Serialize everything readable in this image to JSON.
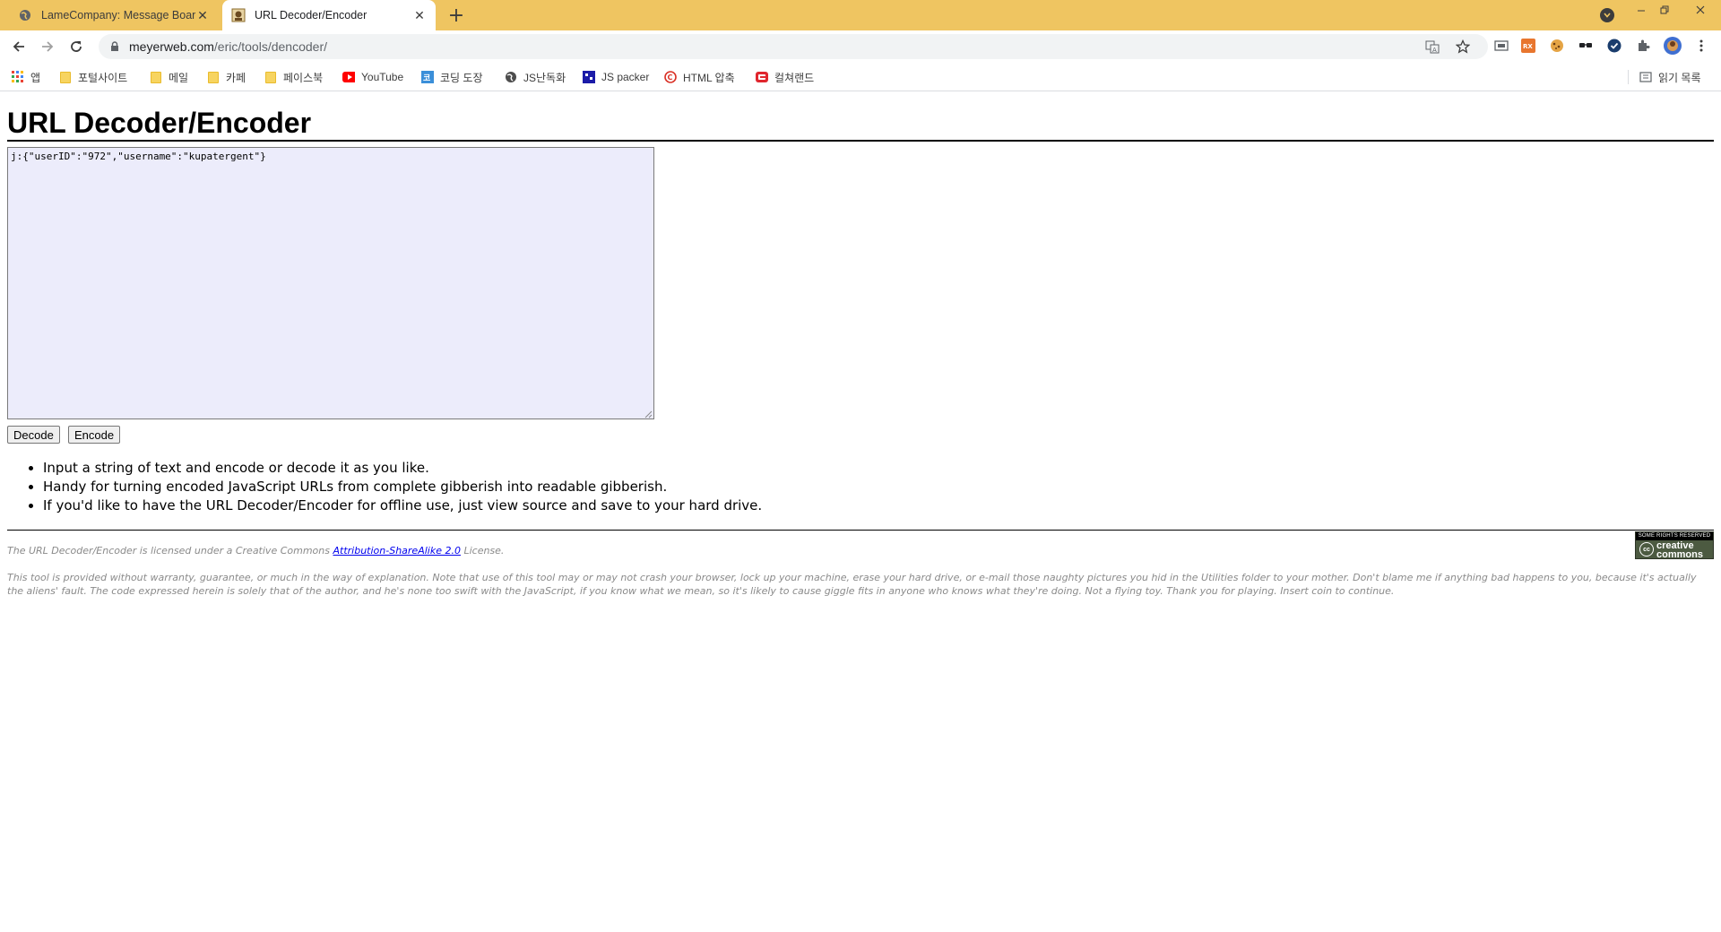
{
  "browser": {
    "tabs": [
      {
        "title": "LameCompany: Message Board",
        "active": false
      },
      {
        "title": "URL Decoder/Encoder",
        "active": true
      }
    ],
    "new_tab_label": "+",
    "url_host": "meyerweb.com",
    "url_path": "/eric/tools/dencoder/",
    "bookmarks": [
      {
        "label": "앱",
        "icon": "apps-grid-icon"
      },
      {
        "label": "포털사이트",
        "icon": "folder-icon"
      },
      {
        "label": "메일",
        "icon": "folder-icon"
      },
      {
        "label": "카페",
        "icon": "folder-icon"
      },
      {
        "label": "페이스북",
        "icon": "folder-icon"
      },
      {
        "label": "YouTube",
        "icon": "youtube-icon"
      },
      {
        "label": "코딩 도장",
        "icon": "site-icon"
      },
      {
        "label": "JS난독화",
        "icon": "globe-icon"
      },
      {
        "label": "JS packer",
        "icon": "site-icon"
      },
      {
        "label": "HTML 압축",
        "icon": "site-icon"
      },
      {
        "label": "컬쳐랜드",
        "icon": "site-icon"
      }
    ],
    "reading_list_label": "읽기 목록",
    "colors": {
      "tabstrip": "#efc561",
      "active_tab": "#ffffff",
      "omnibox": "#f1f3f4"
    }
  },
  "page": {
    "title": "URL Decoder/Encoder",
    "textarea_value": "j:{\"userID\":\"972\",\"username\":\"kupatergent\"}",
    "textarea_bg": "#ececfb",
    "buttons": {
      "decode": "Decode",
      "encode": "Encode"
    },
    "notes": [
      "Input a string of text and encode or decode it as you like.",
      "Handy for turning encoded JavaScript URLs from complete gibberish into readable gibberish.",
      "If you'd like to have the URL Decoder/Encoder for offline use, just view source and save to your hard drive."
    ],
    "license_prefix": "The URL Decoder/Encoder is licensed under a Creative Commons ",
    "license_link": "Attribution-ShareAlike 2.0",
    "license_suffix": " License.",
    "cc_badge_top": "SOME RIGHTS RESERVED",
    "cc_badge_logo": "cc",
    "cc_badge_word": "creative commons",
    "disclaimer": "This tool is provided without warranty, guarantee, or much in the way of explanation. Note that use of this tool may or may not crash your browser, lock up your machine, erase your hard drive, or e-mail those naughty pictures you hid in the Utilities folder to your mother. Don't blame me if anything bad happens to you, because it's actually the aliens' fault. The code expressed herein is solely that of the author, and he's none too swift with the JavaScript, if you know what we mean, so it's likely to cause giggle fits in anyone who knows what they're doing. Not a flying toy. Thank you for playing. Insert coin to continue."
  }
}
